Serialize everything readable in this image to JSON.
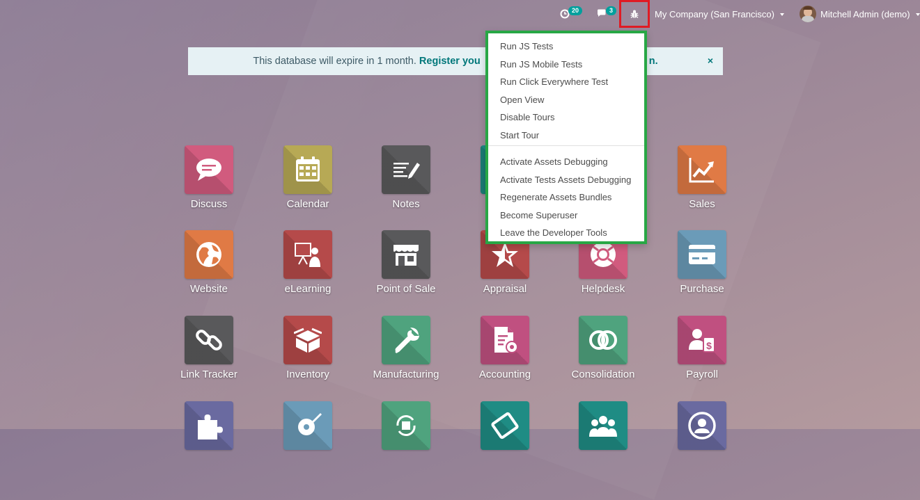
{
  "topbar": {
    "activity_count": "20",
    "messages_count": "3",
    "company": "My Company (San Francisco)",
    "user": "Mitchell Admin (demo)"
  },
  "banner": {
    "text": "This database will expire in 1 month.",
    "link": "Register you",
    "link_tail": "n.",
    "close": "×"
  },
  "debug_menu": {
    "group1": [
      "Run JS Tests",
      "Run JS Mobile Tests",
      "Run Click Everywhere Test",
      "Open View",
      "Disable Tours",
      "Start Tour"
    ],
    "group2": [
      "Activate Assets Debugging",
      "Activate Tests Assets Debugging",
      "Regenerate Assets Bundles",
      "Become Superuser",
      "Leave the Developer Tools"
    ]
  },
  "apps": [
    {
      "label": "Discuss",
      "icon": "chat-bubble-icon",
      "color": "#d15b7e"
    },
    {
      "label": "Calendar",
      "icon": "calendar-icon",
      "color": "#b7a955"
    },
    {
      "label": "Notes",
      "icon": "notes-pencil-icon",
      "color": "#59595b"
    },
    {
      "label": "",
      "icon": "hidden-app-icon",
      "color": "#1f8c84"
    },
    {
      "label": "",
      "icon": "hidden-app-icon",
      "color": "#c05050"
    },
    {
      "label": "Sales",
      "icon": "chart-line-icon",
      "color": "#e07a45"
    },
    {
      "label": "Website",
      "icon": "globe-icon",
      "color": "#e07a45"
    },
    {
      "label": "eLearning",
      "icon": "presenter-icon",
      "color": "#b54a4a"
    },
    {
      "label": "Point of Sale",
      "icon": "store-icon",
      "color": "#59595b"
    },
    {
      "label": "Appraisal",
      "icon": "star-icon",
      "color": "#b54a4a"
    },
    {
      "label": "Helpdesk",
      "icon": "lifebuoy-icon",
      "color": "#d15b7e"
    },
    {
      "label": "Purchase",
      "icon": "credit-card-icon",
      "color": "#6b9bb8"
    },
    {
      "label": "Link Tracker",
      "icon": "link-icon",
      "color": "#59595b"
    },
    {
      "label": "Inventory",
      "icon": "box-icon",
      "color": "#b54a4a"
    },
    {
      "label": "Manufacturing",
      "icon": "wrench-icon",
      "color": "#4fa37e"
    },
    {
      "label": "Accounting",
      "icon": "invoice-gear-icon",
      "color": "#c05080"
    },
    {
      "label": "Consolidation",
      "icon": "overlap-circles-icon",
      "color": "#4fa37e"
    },
    {
      "label": "Payroll",
      "icon": "user-payroll-icon",
      "color": "#c05080"
    },
    {
      "label": "",
      "icon": "puzzle-icon",
      "color": "#6a6aa0"
    },
    {
      "label": "",
      "icon": "gear-pen-icon",
      "color": "#6b9bb8"
    },
    {
      "label": "",
      "icon": "cycle-box-icon",
      "color": "#4fa37e"
    },
    {
      "label": "",
      "icon": "ticket-icon",
      "color": "#1f8c84"
    },
    {
      "label": "",
      "icon": "people-icon",
      "color": "#1f8c84"
    },
    {
      "label": "",
      "icon": "profile-icon",
      "color": "#6a6aa0"
    }
  ]
}
